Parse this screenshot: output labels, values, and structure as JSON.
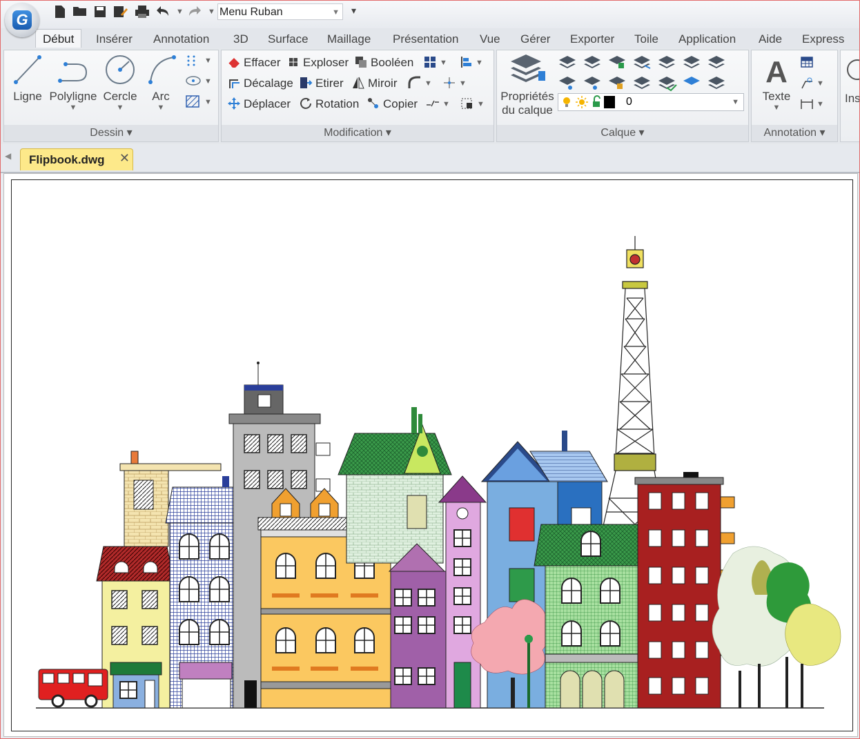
{
  "quick_access": {
    "workspace": "Menu Ruban"
  },
  "tabs": [
    "Début",
    "Insérer",
    "Annotation",
    "3D",
    "Surface",
    "Maillage",
    "Présentation",
    "Vue",
    "Gérer",
    "Exporter",
    "Toile",
    "Application",
    "Aide",
    "Express"
  ],
  "ribbon": {
    "dessin": {
      "title": "Dessin",
      "ligne": "Ligne",
      "polyligne": "Polyligne",
      "cercle": "Cercle",
      "arc": "Arc"
    },
    "modification": {
      "title": "Modification",
      "effacer": "Effacer",
      "exploser": "Exploser",
      "booleen": "Booléen",
      "decalage": "Décalage",
      "etirer": "Etirer",
      "miroir": "Miroir",
      "deplacer": "Déplacer",
      "rotation": "Rotation",
      "copier": "Copier"
    },
    "calque": {
      "title": "Calque",
      "proprietes_line1": "Propriétés",
      "proprietes_line2": "du calque",
      "current_layer": "0"
    },
    "annotation": {
      "title": "Annotation",
      "texte": "Texte"
    },
    "partial_label": "Ins"
  },
  "document": {
    "tab_name": "Flipbook.dwg"
  },
  "colors": {
    "doc_tab": "#fde98a",
    "accent_blue": "#1a5cb0"
  }
}
